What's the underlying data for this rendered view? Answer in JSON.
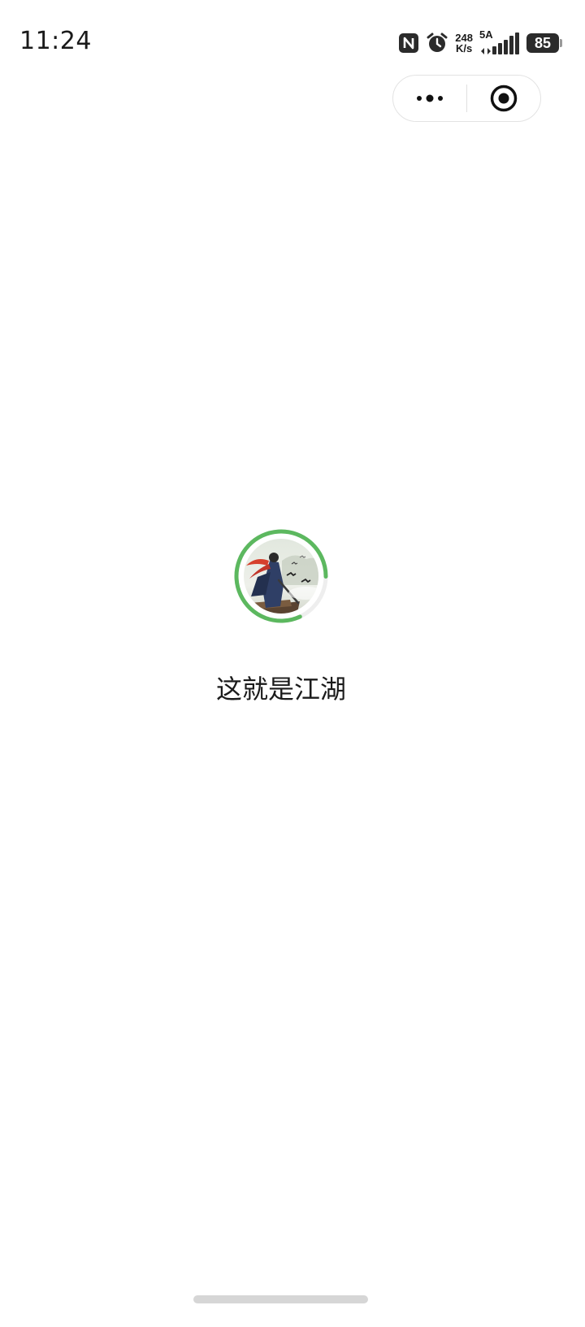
{
  "status_bar": {
    "time": "11:24",
    "net_speed_value": "248",
    "net_speed_unit": "K/s",
    "network_type": "5A",
    "battery_level": "85"
  },
  "capsule": {
    "more_icon": "more-dots-icon",
    "close_icon": "target-close-icon"
  },
  "loading": {
    "avatar_icon": "swordsman-avatar-icon",
    "progress_fraction": 0.82,
    "ring_color": "#5cb85f",
    "app_name": "这就是江湖"
  }
}
